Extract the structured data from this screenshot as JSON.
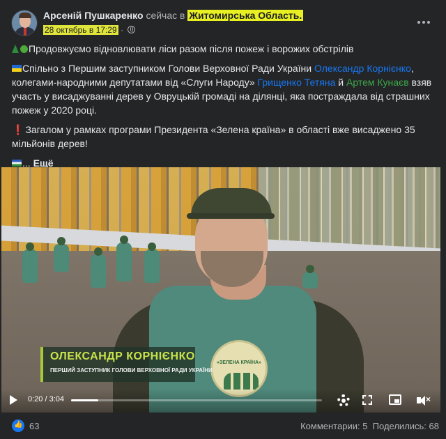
{
  "post": {
    "author": "Арсеній Пушкаренко",
    "status": "сейчас в",
    "location": "Житомирська Область",
    "location_suffix": ".",
    "date": "28 октябрь в 17:29",
    "date_separator": "·"
  },
  "body": {
    "line1": "Продовжуємо відновлювати ліси разом після пожеж і ворожих обстрілів",
    "p2_a": "Спільно з Першим заступником Голови Верховної Ради України ",
    "p2_tag1": "Олександр Корнієнко",
    "p2_b": ", колегами-народними депутатами від «Слуги Народу» ",
    "p2_tag2": "Грищенко Тетяна",
    "p2_c": " й ",
    "p2_tag3": "Артем Кунаєв",
    "p2_d": " взяв участь у висаджуванні дерев у Овруцькій громаді на ділянці, яка постраждала від страшних пожеж у 2020 році.",
    "p3": "Загалом у рамках програми Президента «Зелена країна» в області вже висаджено 35 мільйонів дерев!",
    "ellipsis": "...",
    "see_more": "Ещё"
  },
  "video": {
    "lower_third_name": "ОЛЕКСАНДР КОРНІЄНКО",
    "lower_third_role": "ПЕРШИЙ ЗАСТУПНИК ГОЛОВИ ВЕРХОВНОЇ РАДИ УКРАЇНИ",
    "badge_text": "«ЗЕЛЕНА КРАЇНА»",
    "time_current": "0:20",
    "time_separator": "/",
    "time_total": "3:04",
    "progress_fraction": 0.109
  },
  "footer": {
    "likes": "63",
    "comments": "Комментарии: 5",
    "shares": "Поделились: 68"
  },
  "icons": {
    "more": "more-horizontal-icon",
    "privacy": "globe-icon",
    "play": "play-icon",
    "settings": "gear-icon",
    "fullscreen": "fullscreen-icon",
    "pip": "picture-in-picture-icon",
    "mute": "mute-icon",
    "like": "like-icon"
  },
  "colors": {
    "background": "#242526",
    "link": "#1877f2",
    "link_green": "#3ea84c",
    "highlight": "#e9f021"
  }
}
